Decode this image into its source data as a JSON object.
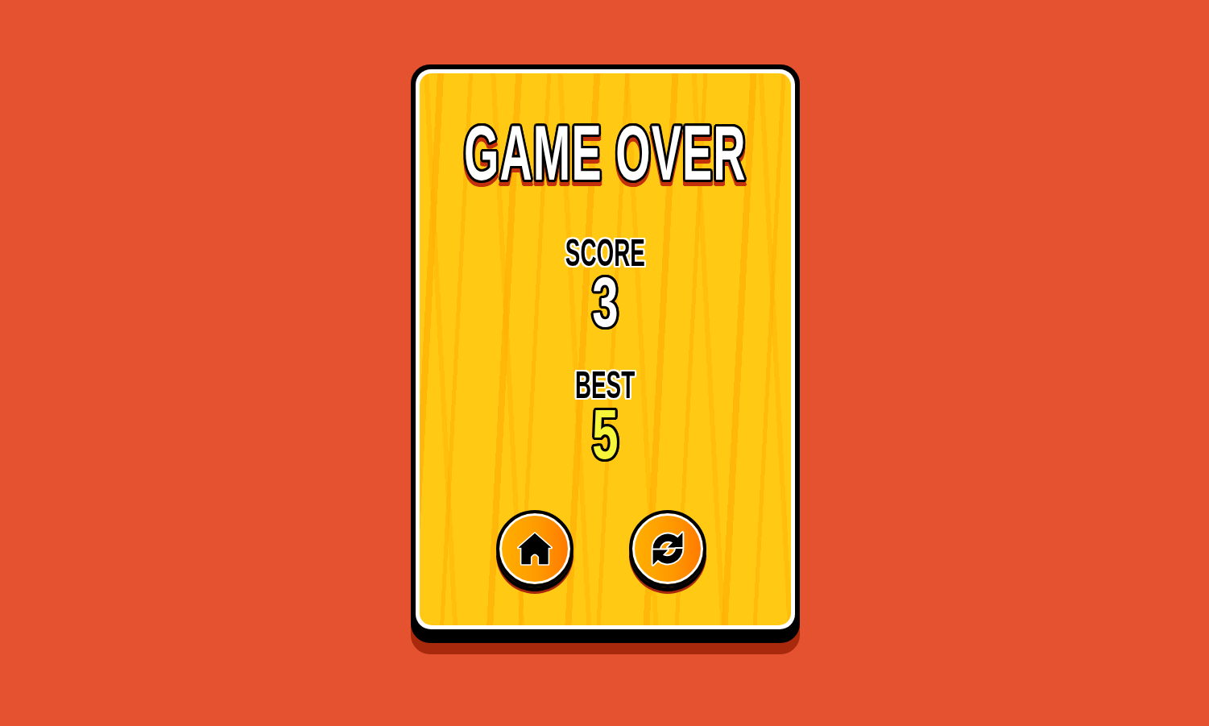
{
  "title": "GAME OVER",
  "stats": [
    {
      "kind": "current",
      "label": "SCORE",
      "value": "3"
    },
    {
      "kind": "best",
      "label": "BEST",
      "value": "5"
    }
  ],
  "buttons": [
    {
      "kind": "home"
    },
    {
      "kind": "restart"
    }
  ]
}
